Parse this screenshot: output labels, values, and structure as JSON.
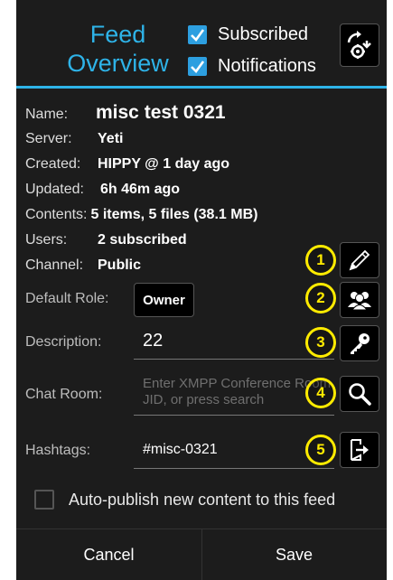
{
  "header": {
    "title_line1": "Feed",
    "title_line2": "Overview",
    "subscribed_label": "Subscribed",
    "notifications_label": "Notifications",
    "subscribed_checked": true,
    "notifications_checked": true
  },
  "info": [
    {
      "key": "Name:",
      "value": "misc test 0321"
    },
    {
      "key": "Server:",
      "value": "Yeti"
    },
    {
      "key": "Created:",
      "value": "HIPPY @ 1 day ago"
    },
    {
      "key": "Updated:",
      "value": "6h 46m ago"
    },
    {
      "key": "Contents:",
      "value": "5 items, 5 files (38.1 MB)"
    },
    {
      "key": "Users:",
      "value": "2 subscribed"
    },
    {
      "key": "Channel:",
      "value": "Public"
    }
  ],
  "form": {
    "default_role_label": "Default Role:",
    "default_role_value": "Owner",
    "description_label": "Description:",
    "description_value": "22",
    "chat_room_label": "Chat Room:",
    "chat_room_placeholder": "Enter XMPP Conference Room JID, or press search",
    "hashtags_label": "Hashtags:",
    "hashtags_value": "#misc-0321"
  },
  "badges": [
    "1",
    "2",
    "3",
    "4",
    "5"
  ],
  "icons": {
    "sync": "sync-settings-icon",
    "edit": "pencil-icon",
    "users": "users-icon",
    "key": "key-icon",
    "search": "search-icon",
    "export": "export-icon"
  },
  "auto_publish_label": "Auto-publish new content to this feed",
  "auto_publish_checked": false,
  "footer": {
    "cancel_label": "Cancel",
    "save_label": "Save"
  },
  "colors": {
    "accent": "#2eb3e8",
    "badge": "#ffeb00",
    "background": "#1c1c1c"
  }
}
